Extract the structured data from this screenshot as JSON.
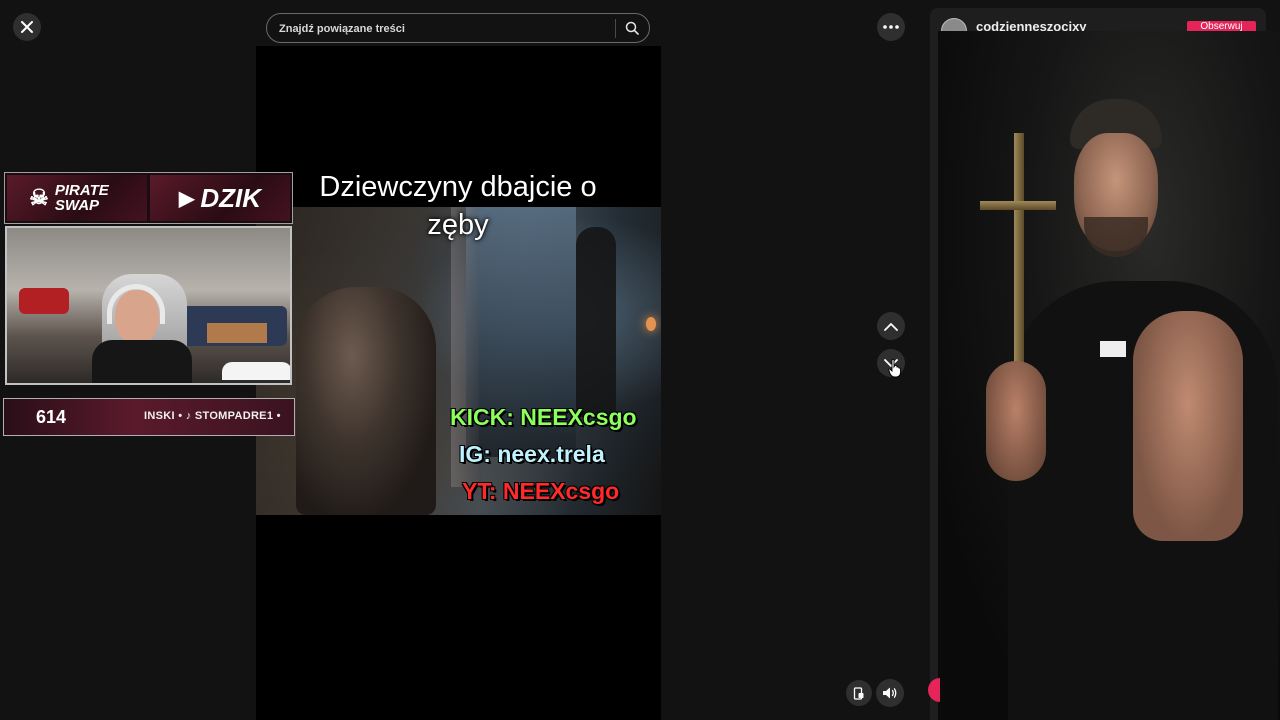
{
  "search": {
    "placeholder": "Znajdź powiązane treści"
  },
  "video": {
    "caption": "Dziewczyny dbajcie o zęby",
    "overlay_lines": [
      {
        "prefix": "KICK: ",
        "handle": "NEEXcsgo",
        "color": "#8cff5a"
      },
      {
        "prefix": "IG: ",
        "handle": "neex.trela",
        "color": "#bff2ff"
      },
      {
        "prefix": "YT: ",
        "handle": "NEEXcsgo",
        "color": "#ff2a2a"
      }
    ],
    "sponsors": [
      "PIRATE SWAP",
      "DZIK"
    ],
    "counter": "614",
    "ticker": "INSKI • ♪ STOMPADRE1 •"
  },
  "side_panel": {
    "author": "codzienneszocixy",
    "follow_label": "Obserwuj"
  },
  "icons": {
    "close": "close-icon",
    "more": "more-icon",
    "search": "search-icon",
    "up": "chevron-up-icon",
    "down": "chevron-down-icon",
    "pip": "picture-in-picture-icon",
    "volume": "volume-icon"
  },
  "colors": {
    "background": "#121212",
    "accent": "#e5245a"
  }
}
